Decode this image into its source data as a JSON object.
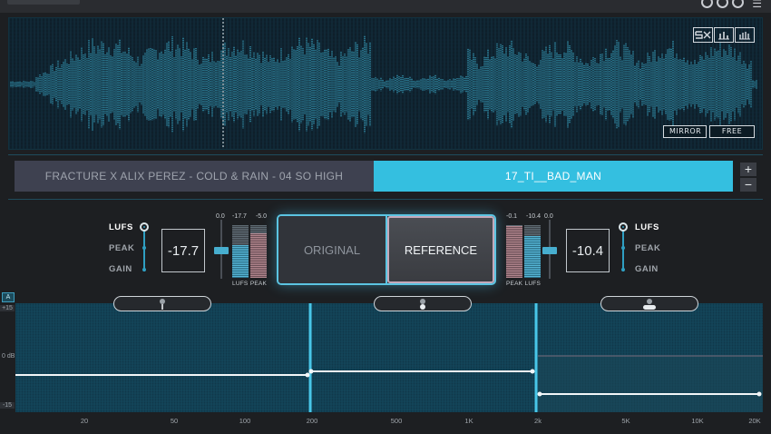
{
  "window": {
    "icons": [
      "circle-icon",
      "circle-icon",
      "circle-icon",
      "menu-icon"
    ]
  },
  "waveform": {
    "view_icons": [
      "sx-view-icon",
      "bars-view-icon",
      "bars-alt-view-icon"
    ],
    "buttons": {
      "mirror": "MIRROR",
      "free": "FREE"
    },
    "accent": "#3fb5d6"
  },
  "tracks": {
    "original": "FRACTURE X ALIX PEREZ - COLD & RAIN - 04 SO HIGH",
    "reference": "17_TI__BAD_MAN",
    "add": "+",
    "remove": "−",
    "active_color": "#34bfe0"
  },
  "left_meter": {
    "modes": [
      "LUFS",
      "PEAK",
      "GAIN"
    ],
    "active_mode": "LUFS",
    "value": "-17.7",
    "gain_value": "0.0",
    "lufs_value": "-17.7",
    "peak_value": "-5.0",
    "labels": {
      "lufs": "LUFS",
      "peak": "PEAK"
    },
    "lufs_level": 0.62,
    "peak_level": 0.85
  },
  "right_meter": {
    "modes": [
      "LUFS",
      "PEAK",
      "GAIN"
    ],
    "active_mode": "LUFS",
    "value": "-10.4",
    "gain_value": "0.0",
    "peak_value": "-0.1",
    "lufs_value": "-10.4",
    "labels": {
      "peak": "PEAK",
      "lufs": "LUFS"
    },
    "peak_level": 0.98,
    "lufs_level": 0.8
  },
  "ab_switch": {
    "original": "ORIGINAL",
    "reference": "REFERENCE",
    "selected": "REFERENCE"
  },
  "eq": {
    "scale_toggle": "A",
    "db_top": "+15",
    "db_mid": "0 dB",
    "db_bottom": "-15",
    "freq_labels": [
      "20",
      "50",
      "100",
      "200",
      "500",
      "1K",
      "2k",
      "5K",
      "10K",
      "20K"
    ],
    "band_handles": [
      "band-low-handle",
      "band-mid-handle",
      "band-high-handle"
    ]
  }
}
